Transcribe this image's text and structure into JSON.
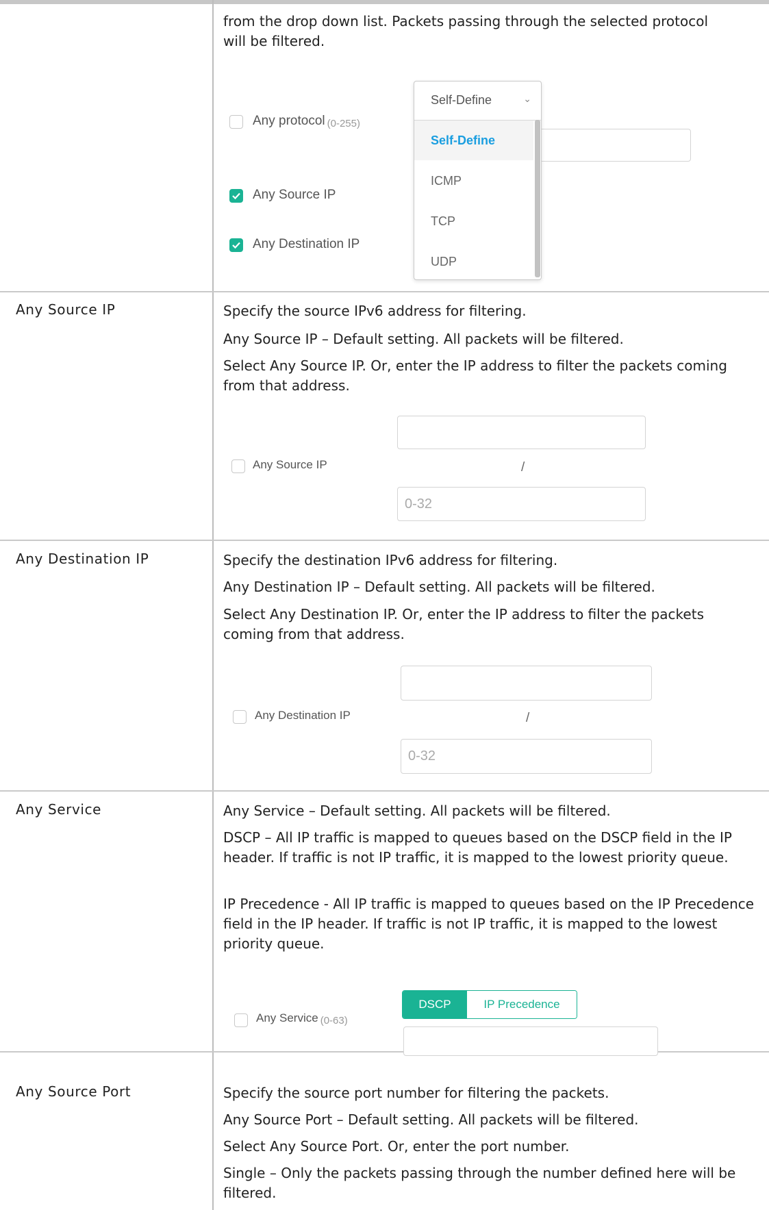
{
  "protocol_section": {
    "text": "from the drop down list. Packets passing through the selected protocol will be filtered.",
    "any_protocol_label": "Any protocol",
    "any_protocol_range": "(0-255)",
    "any_source_ip_label": "Any Source IP",
    "any_destination_ip_label": "Any Destination IP",
    "dropdown": {
      "selected": "Self-Define",
      "options": [
        "Self-Define",
        "ICMP",
        "TCP",
        "UDP"
      ]
    }
  },
  "source_ip_section": {
    "label": "Any Source IP",
    "lines": [
      "Specify the source IPv6 address for filtering.",
      "Any Source IP – Default setting. All packets will be filtered.",
      "Select Any Source IP. Or, enter the IP address to filter the packets coming from that address."
    ],
    "checkbox_label": "Any Source IP",
    "slash": "/",
    "mask_placeholder": "0-32"
  },
  "destination_ip_section": {
    "label": "Any Destination IP",
    "lines": [
      "Specify the destination IPv6 address for filtering.",
      "Any Destination IP – Default setting. All packets will be filtered.",
      "Select Any Destination IP. Or, enter the IP address to filter the packets coming from that address."
    ],
    "checkbox_label": "Any Destination IP",
    "slash": "/",
    "mask_placeholder": "0-32"
  },
  "service_section": {
    "label": "Any Service",
    "lines": [
      "Any Service – Default setting. All packets will be filtered.",
      "DSCP – All IP traffic is mapped to queues based on the DSCP field in the IP header. If traffic is not IP traffic, it is mapped to the lowest priority queue.",
      "IP Precedence - All IP traffic is mapped to queues based on the IP Precedence field in the IP header. If traffic is not IP traffic, it is mapped to the lowest priority queue."
    ],
    "checkbox_label": "Any Service",
    "checkbox_range": "(0-63)",
    "segments": [
      "DSCP",
      "IP Precedence"
    ]
  },
  "source_port_section": {
    "label": "Any Source Port",
    "lines": [
      "Specify the source port number for filtering the packets.",
      "Any Source Port – Default setting. All packets will be filtered.",
      "Select Any Source Port. Or, enter the port number.",
      "Single – Only the packets passing through the number defined here will be filtered."
    ]
  },
  "colors": {
    "accent": "#1ab394",
    "link_blue": "#1a9ee0",
    "border": "#c9c9c9"
  }
}
